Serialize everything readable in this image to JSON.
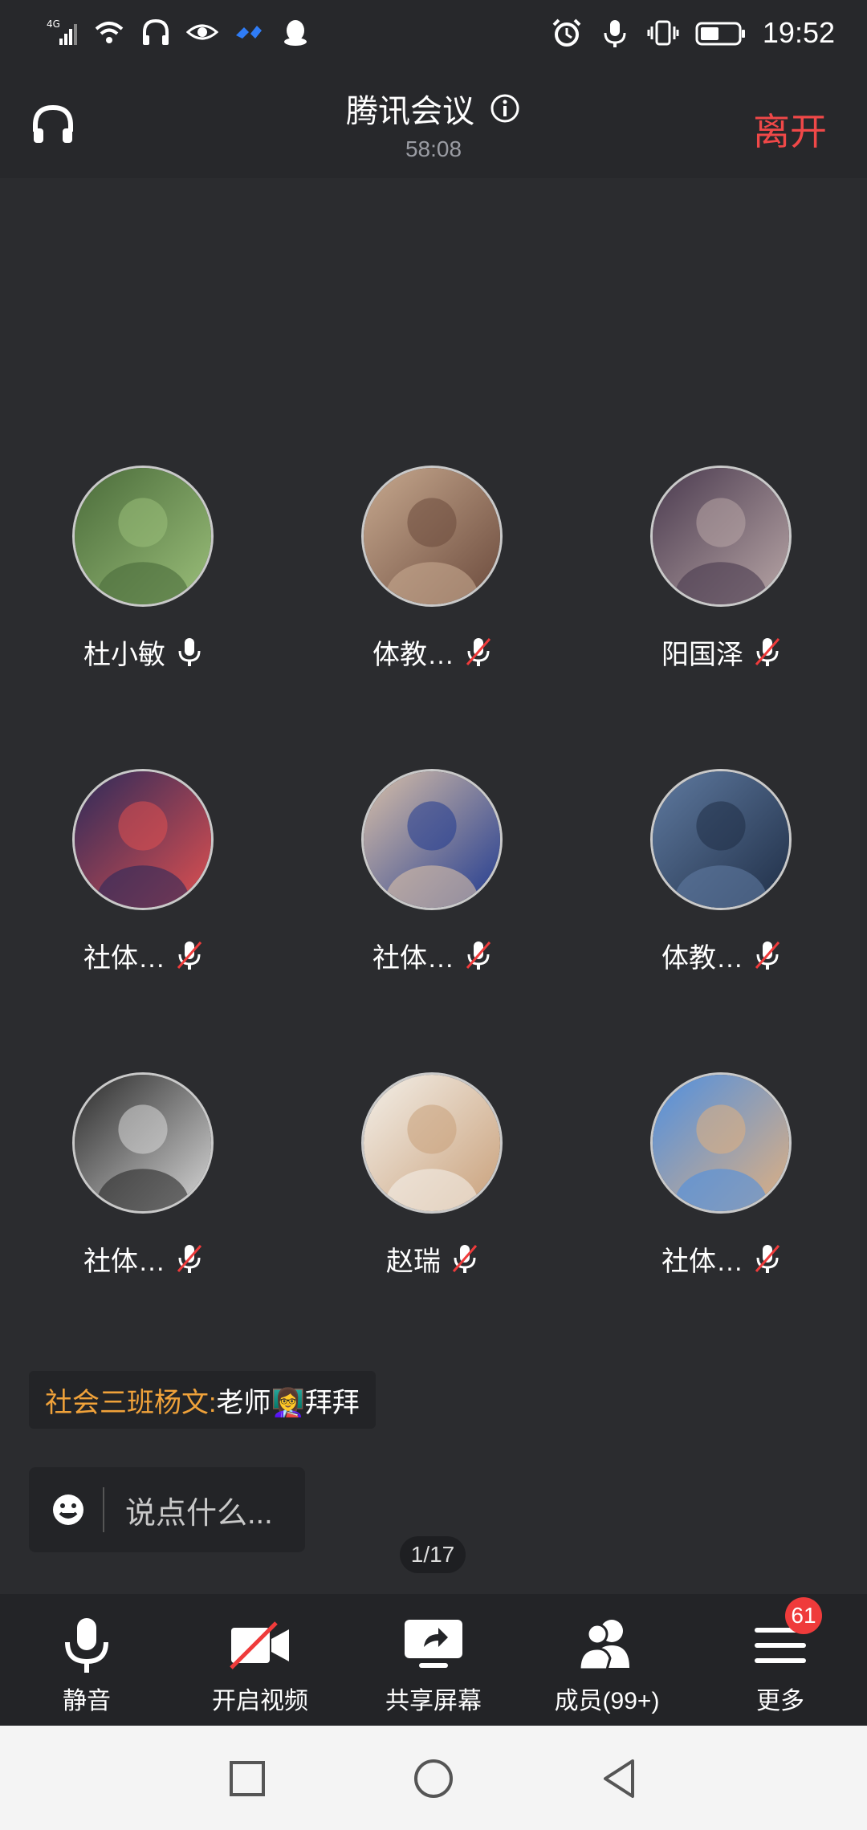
{
  "status_bar": {
    "time": "19:52",
    "network": "4G"
  },
  "header": {
    "title": "腾讯会议",
    "duration": "58:08",
    "leave_label": "离开"
  },
  "participants": [
    {
      "name": "杜小敏",
      "mic": "on",
      "colors": [
        "#4a6b3a",
        "#9bbf7a"
      ]
    },
    {
      "name": "体教…",
      "mic": "off",
      "colors": [
        "#c7a98f",
        "#6b4a3c"
      ]
    },
    {
      "name": "阳国泽",
      "mic": "off",
      "colors": [
        "#4a3a4f",
        "#b8a6a6"
      ]
    },
    {
      "name": "社体…",
      "mic": "off",
      "colors": [
        "#2b2a5a",
        "#e05050"
      ]
    },
    {
      "name": "社体…",
      "mic": "off",
      "colors": [
        "#d9c0a8",
        "#203a90"
      ]
    },
    {
      "name": "体教…",
      "mic": "off",
      "colors": [
        "#5f7aa0",
        "#1f2e46"
      ]
    },
    {
      "name": "社体…",
      "mic": "off",
      "colors": [
        "#2a2a2a",
        "#d8d8d8"
      ]
    },
    {
      "name": "赵瑞",
      "mic": "off",
      "colors": [
        "#f3efe8",
        "#c9a07a"
      ]
    },
    {
      "name": "社体…",
      "mic": "off",
      "colors": [
        "#4f8fe0",
        "#e0b080"
      ]
    }
  ],
  "chat": {
    "sender": "社会三班杨文:",
    "message": " 老师👩‍🏫拜拜"
  },
  "input": {
    "placeholder": "说点什么..."
  },
  "pager": {
    "label": "1/17"
  },
  "toolbar": {
    "mute_label": "静音",
    "video_label": "开启视频",
    "share_label": "共享屏幕",
    "members_label": "成员(99+)",
    "more_label": "更多",
    "more_badge": "61"
  }
}
